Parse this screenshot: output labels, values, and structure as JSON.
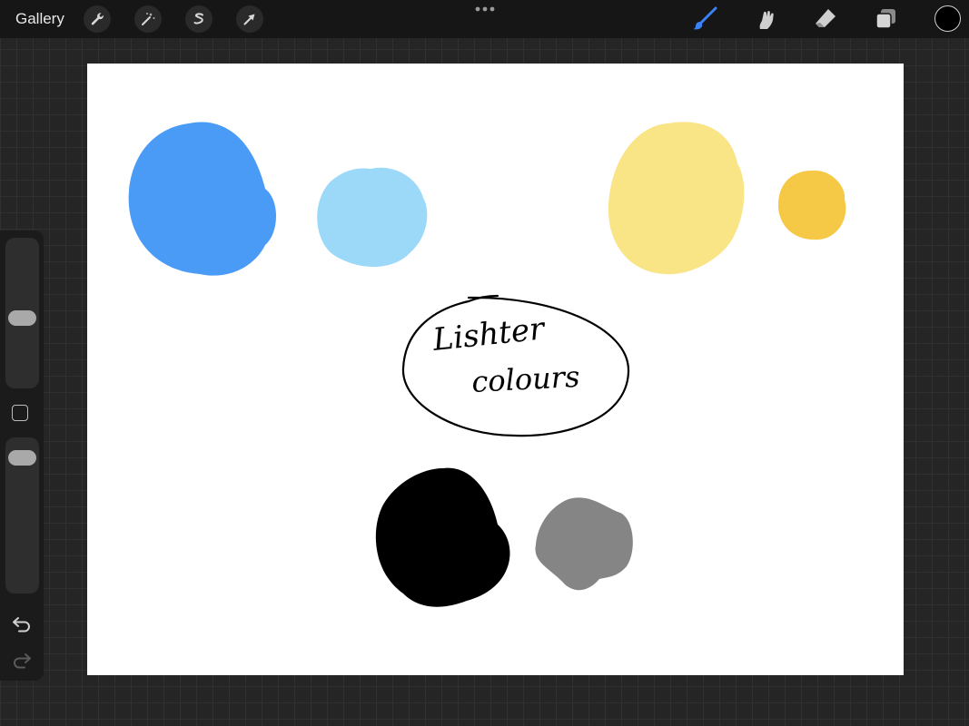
{
  "topbar": {
    "gallery_label": "Gallery",
    "left_tools": [
      "wrench-icon",
      "magic-wand-icon",
      "selection-s-icon",
      "transform-arrow-icon"
    ],
    "right_tools": [
      "brush-icon",
      "smudge-icon",
      "eraser-icon",
      "layers-icon"
    ],
    "active_tool": "brush",
    "current_color": "#000000",
    "accent_color": "#3b82f6"
  },
  "sidebar": {
    "controls": [
      "brush-size-slider",
      "modifier-button",
      "opacity-slider",
      "undo-icon",
      "redo-icon"
    ]
  },
  "canvas": {
    "handwriting": [
      "Lishter",
      "colours"
    ],
    "swatches": [
      "#4a9bf6",
      "#9cd9f8",
      "#f9e486",
      "#f5c945",
      "#000000",
      "#858585"
    ],
    "background": "#ffffff"
  }
}
